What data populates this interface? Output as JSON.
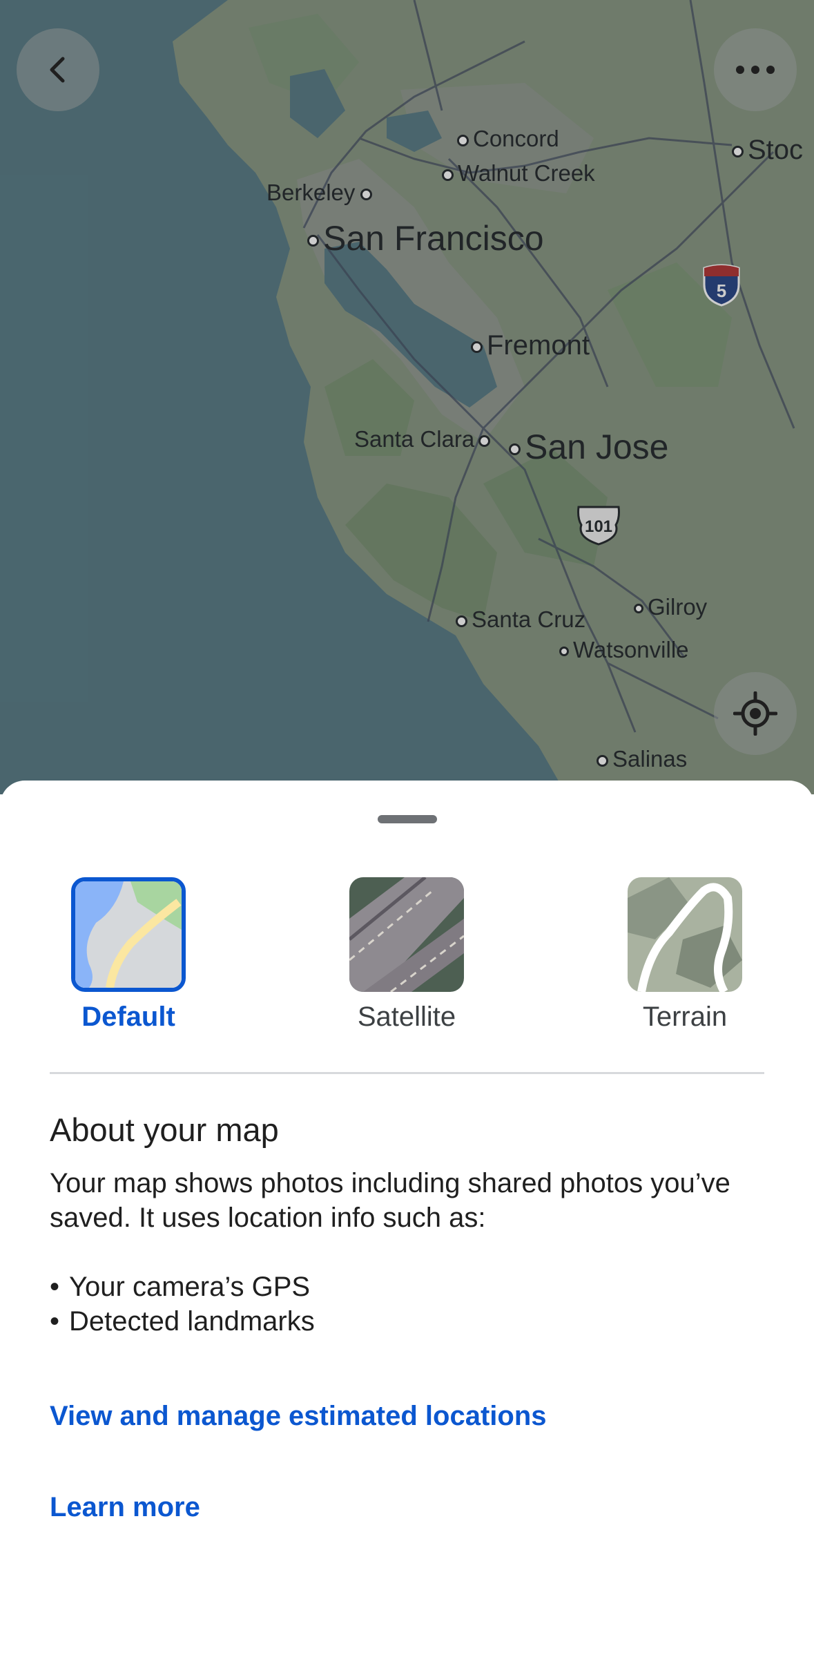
{
  "map": {
    "cities": [
      {
        "name": "Concord",
        "size": "sm"
      },
      {
        "name": "Walnut Creek",
        "size": "sm"
      },
      {
        "name": "Berkeley",
        "size": "sm"
      },
      {
        "name": "San Francisco",
        "size": "big"
      },
      {
        "name": "Fremont",
        "size": "med"
      },
      {
        "name": "Santa Clara",
        "size": "sm"
      },
      {
        "name": "San Jose",
        "size": "big"
      },
      {
        "name": "Santa Cruz",
        "size": "sm"
      },
      {
        "name": "Gilroy",
        "size": "sm"
      },
      {
        "name": "Watsonville",
        "size": "sm"
      },
      {
        "name": "Salinas",
        "size": "sm"
      },
      {
        "name": "Stoc",
        "size": "med"
      }
    ],
    "shields": [
      "5",
      "101"
    ],
    "back_icon": "chevron-left-icon",
    "more_icon": "more-horizontal-icon",
    "locate_icon": "my-location-icon"
  },
  "sheet": {
    "map_types": [
      {
        "label": "Default",
        "selected": true
      },
      {
        "label": "Satellite",
        "selected": false
      },
      {
        "label": "Terrain",
        "selected": false
      }
    ],
    "about_title": "About your map",
    "about_body": "Your map shows photos including shared photos you’ve saved. It uses location info such as:",
    "bullets": [
      "Your camera’s GPS",
      "Detected landmarks"
    ],
    "link_manage": "View and manage estimated locations",
    "link_learn": "Learn more"
  },
  "colors": {
    "accent": "#0b57d0",
    "water": "#5a7f8a",
    "land": "#8a9a84"
  }
}
